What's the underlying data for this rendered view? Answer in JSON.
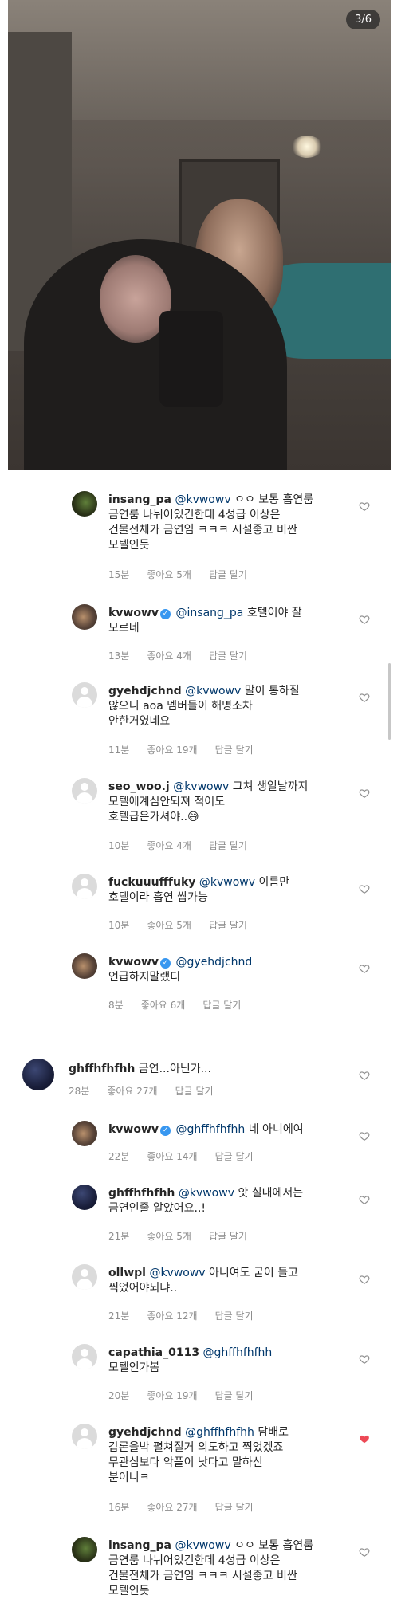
{
  "photo": {
    "counter": "3/6"
  },
  "comments": [
    {
      "user": "insang_pa",
      "verified": false,
      "mention": "@kvwowv",
      "text": " ㅇㅇ 보통 흡연룸\n금연룸 나뉘어있긴한데 4성급 이상은\n건물전체가 금연임 ㅋㅋㅋ 시설좋고 비싼\n모텔인듯",
      "time": "15분",
      "likes": "좋아요 5개",
      "reply": "답글 달기",
      "liked": false
    },
    {
      "user": "kvwowv",
      "verified": true,
      "mention": "@insang_pa",
      "text": " 호텔이야 잘\n모르네",
      "time": "13분",
      "likes": "좋아요 4개",
      "reply": "답글 달기",
      "liked": false
    },
    {
      "user": "gyehdjchnd",
      "verified": false,
      "mention": "@kvwowv",
      "text": " 말이 통하질\n않으니 aoa 멤버들이 해명조차\n안한거였네요",
      "time": "11분",
      "likes": "좋아요 19개",
      "reply": "답글 달기",
      "liked": false
    },
    {
      "user": "seo_woo.j",
      "verified": false,
      "mention": "@kvwowv",
      "text": " 그쳐 생일날까지\n모텔에계심안되져 적어도\n호텔급은가셔야..😅",
      "time": "10분",
      "likes": "좋아요 4개",
      "reply": "답글 달기",
      "liked": false
    },
    {
      "user": "fuckuuufffuky",
      "verified": false,
      "mention": "@kvwowv",
      "text": " 이름만\n호텔이라 흡연 쌉가능",
      "time": "10분",
      "likes": "좋아요 5개",
      "reply": "답글 달기",
      "liked": false
    },
    {
      "user": "kvwowv",
      "verified": true,
      "mention": "@gyehdjchnd",
      "text": "\n언급하지말랬디",
      "time": "8분",
      "likes": "좋아요 6개",
      "reply": "답글 달기",
      "liked": false
    },
    {
      "user": "ghffhfhfhh",
      "verified": false,
      "mention": "",
      "text": "금연...아닌가...",
      "time": "28분",
      "likes": "좋아요 27개",
      "reply": "답글 달기",
      "liked": false
    },
    {
      "user": "kvwowv",
      "verified": true,
      "mention": "@ghffhfhfhh",
      "text": " 네 아니에여",
      "time": "22분",
      "likes": "좋아요 14개",
      "reply": "답글 달기",
      "liked": false
    },
    {
      "user": "ghffhfhfhh",
      "verified": false,
      "mention": "@kvwowv",
      "text": " 앗 실내에서는\n금연인줄 알았어요..!",
      "time": "21분",
      "likes": "좋아요 5개",
      "reply": "답글 달기",
      "liked": false
    },
    {
      "user": "ollwpl",
      "verified": false,
      "mention": "@kvwowv",
      "text": " 아니여도 굳이 들고\n찍었어야되냐..",
      "time": "21분",
      "likes": "좋아요 12개",
      "reply": "답글 달기",
      "liked": false
    },
    {
      "user": "capathia_0113",
      "verified": false,
      "mention": "@ghffhfhfhh",
      "text": "\n모텔인가봄",
      "time": "20분",
      "likes": "좋아요 19개",
      "reply": "답글 달기",
      "liked": false
    },
    {
      "user": "gyehdjchnd",
      "verified": false,
      "mention": "@ghffhfhfhh",
      "text": " 담배로\n갑론을박 펼쳐질거 의도하고 찍었겠죠\n무관심보다 악플이 낫다고 말하신\n분이니ㅋ",
      "time": "16분",
      "likes": "좋아요 27개",
      "reply": "답글 달기",
      "liked": true
    },
    {
      "user": "insang_pa",
      "verified": false,
      "mention": "@kvwowv",
      "text": " ㅇㅇ 보통 흡연룸\n금연룸 나뉘어있긴한데 4성급 이상은\n건물전체가 금연임 ㅋㅋㅋ 시설좋고 비싼\n모텔인듯",
      "time": "",
      "likes": "",
      "reply": "",
      "liked": false
    }
  ],
  "colors": {
    "mention": "#00376b",
    "verified": "#3897f0",
    "heart_liked": "#ed4956",
    "meta": "#8e8e8e"
  },
  "icons": {
    "heart": "heart-icon",
    "verified": "verified-badge-icon"
  }
}
